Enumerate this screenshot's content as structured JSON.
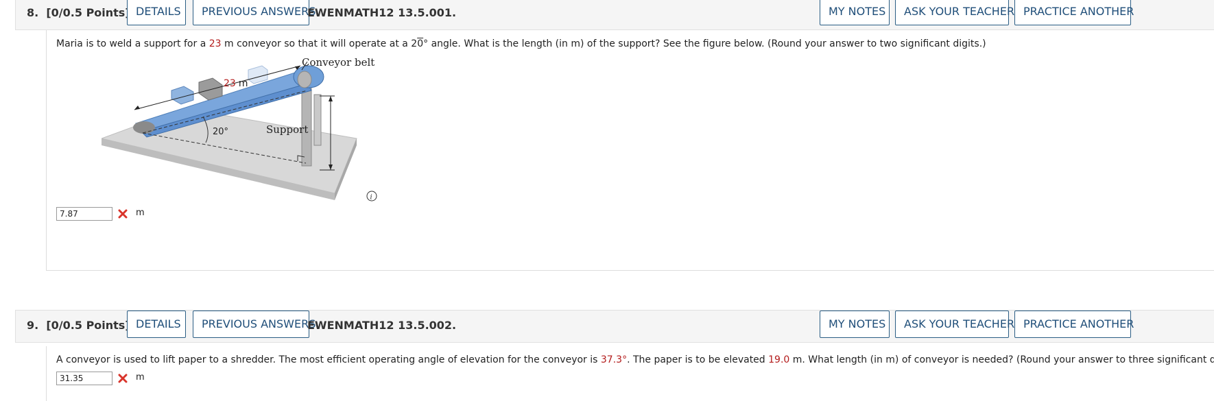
{
  "questions": [
    {
      "number": "8.",
      "points": "[0/0.5 Points]",
      "details_label": "DETAILS",
      "previous_answers_label": "PREVIOUS ANSWERS",
      "code": "EWENMATH12 13.5.001.",
      "my_notes_label": "MY NOTES",
      "ask_teacher_label": "ASK YOUR TEACHER",
      "practice_label": "PRACTICE ANOTHER",
      "text_parts": {
        "a": "Maria is to weld a support for a ",
        "value": "23",
        "b": " m conveyor so that it will operate at a ",
        "angle_digits_1": "2",
        "angle_digits_2": "0",
        "c": "° angle. What is the length (in m) of the support? See the figure below. (Round your answer to two significant digits.)"
      },
      "figure": {
        "belt_label": "Conveyor belt",
        "length_value": "23",
        "length_unit": "m",
        "angle_label": "20°",
        "support_label": "Support",
        "info_icon": "info-icon"
      },
      "answer_value": "7.87",
      "status_icon": "wrong-x-icon",
      "unit": "m"
    },
    {
      "number": "9.",
      "points": "[0/0.5 Points]",
      "details_label": "DETAILS",
      "previous_answers_label": "PREVIOUS ANSWERS",
      "code": "EWENMATH12 13.5.002.",
      "my_notes_label": "MY NOTES",
      "ask_teacher_label": "ASK YOUR TEACHER",
      "practice_label": "PRACTICE ANOTHER",
      "text_parts": {
        "a": "A conveyor is used to lift paper to a shredder. The most efficient operating angle of elevation for the conveyor is ",
        "angle": "37.3°",
        "b": ". The paper is to be elevated ",
        "height": "19.0",
        "c": " m. What length (in m) of conveyor is needed? (Round your answer to three significant digits.)"
      },
      "answer_value": "31.35",
      "status_icon": "wrong-x-icon",
      "unit": "m"
    }
  ],
  "colors": {
    "accent": "#1f4e79",
    "given_value": "#b31b1b",
    "wrong": "#d9342b",
    "belt": "#6f9fd8",
    "base": "#d4d4d4"
  }
}
